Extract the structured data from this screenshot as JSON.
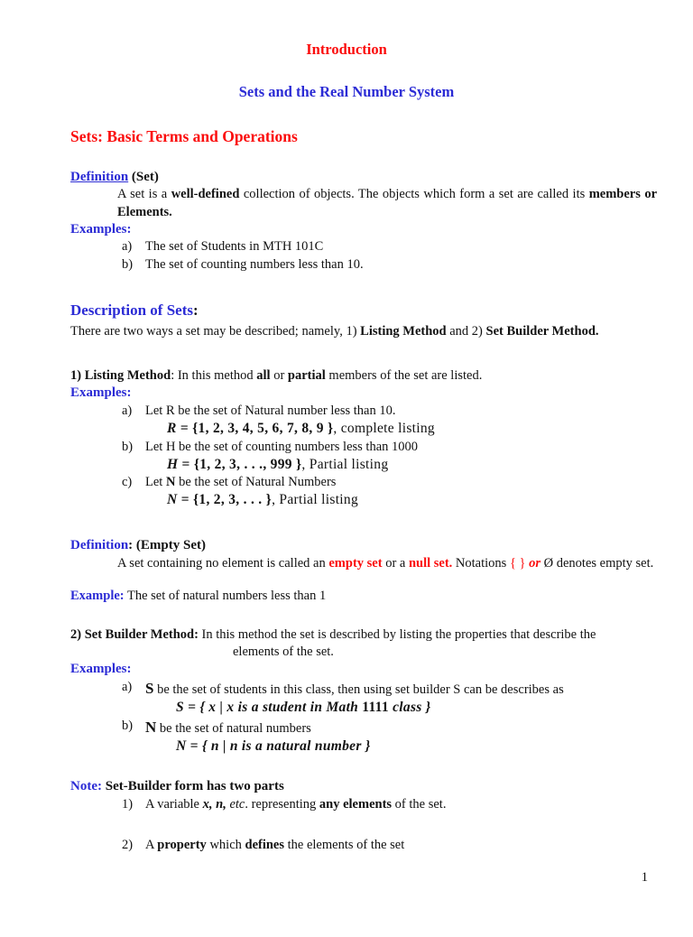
{
  "document": {
    "title": "Introduction",
    "subtitle": "Sets and the Real Number System",
    "section_heading": "Sets: Basic Terms and Operations",
    "page_number": "1"
  },
  "colors": {
    "red": "#fb0d0d",
    "blue": "#2b2bd5",
    "black": "#111111"
  },
  "definition_set": {
    "label": "Definition",
    "label_suffix": "(Set)",
    "body_1": "A set is a",
    "body_bold_1": "well-defined",
    "body_2": "collection of objects. The objects which form a set are called its",
    "body_bold_2": "members or Elements.",
    "examples_label": "Examples:",
    "items": [
      {
        "marker": "a)",
        "text": "The set of Students in MTH 101C"
      },
      {
        "marker": "b)",
        "text": "The set of counting numbers less than 10."
      }
    ]
  },
  "description_of_sets": {
    "heading": "Description of Sets",
    "heading_colon": ":",
    "intro_1": "There are two ways a set may be described; namely, 1)",
    "intro_bold_1": "Listing Method",
    "intro_2": "and 2)",
    "intro_bold_2": "Set Builder Method."
  },
  "listing_method": {
    "number": "1)",
    "name": "Listing Method",
    "body_1": ": In this method",
    "body_bold_1": "all",
    "body_2": "or",
    "body_bold_2": "partial",
    "body_3": "members of the set are listed.",
    "examples_label": "Examples:",
    "items": [
      {
        "marker": "a)",
        "text": "Let R be the set of Natural number less than 10.",
        "equation_var": "R",
        "equation_rest": "= {1,  2,  3,  4,  5,   6,  7,  8, 9 }",
        "equation_note": ", complete listing"
      },
      {
        "marker": "b)",
        "text": "Let H be the set of counting numbers less than 1000",
        "equation_var": "H",
        "equation_rest": "= {1,  2,  3,  .  .  .,   999 }",
        "equation_note": ", Partial listing"
      },
      {
        "marker": "c)",
        "text_pre": "Let ",
        "text_bold": "N",
        "text_post": " be the set of Natural Numbers",
        "equation_var": "N",
        "equation_rest": "= {1,  2,  3,  .  .  .   }",
        "equation_note": ", Partial listing"
      }
    ]
  },
  "definition_empty_set": {
    "label": "Definition",
    "label_suffix": ": (Empty Set)",
    "body_1": "A set containing no element is called an",
    "body_red_1": "empty set",
    "body_2": "or a",
    "body_red_2": "null set.",
    "body_3": "Notations",
    "notation_braces": "{ }",
    "notation_or": "or",
    "notation_phi": "Ø",
    "body_4": "denotes empty set.",
    "example_label": "Example:",
    "example_text": "The set of natural numbers less than 1"
  },
  "set_builder_method": {
    "number": "2)",
    "name": "Set Builder Method:",
    "body_1": "In this method the set is described by listing the properties that describe the",
    "body_2": "elements of the set.",
    "examples_label": "Examples:",
    "items": [
      {
        "marker": "a)",
        "symbol": "S",
        "text": "be the set of students in this class, then using set builder S can be describes as",
        "equation": "S = { x | x  is  a  student  in Math",
        "equation_upright": "1111",
        "equation_tail": "class }"
      },
      {
        "marker": "b)",
        "symbol": "N",
        "text": "be the set of natural numbers",
        "equation": "N = { n |  n is a natural number }",
        "equation_upright": "",
        "equation_tail": ""
      }
    ]
  },
  "note": {
    "label": "Note:",
    "heading": "Set-Builder form has two parts",
    "items": [
      {
        "marker": "1)",
        "pre": "A variable ",
        "vars": "x,  n,",
        "etc": " etc",
        "mid": ". representing ",
        "bold": "any elements",
        "post": " of the set."
      },
      {
        "marker": "2)",
        "pre": "A ",
        "bold1": "property",
        "mid": " which ",
        "bold2": "defines",
        "post": " the elements of the set"
      }
    ]
  }
}
